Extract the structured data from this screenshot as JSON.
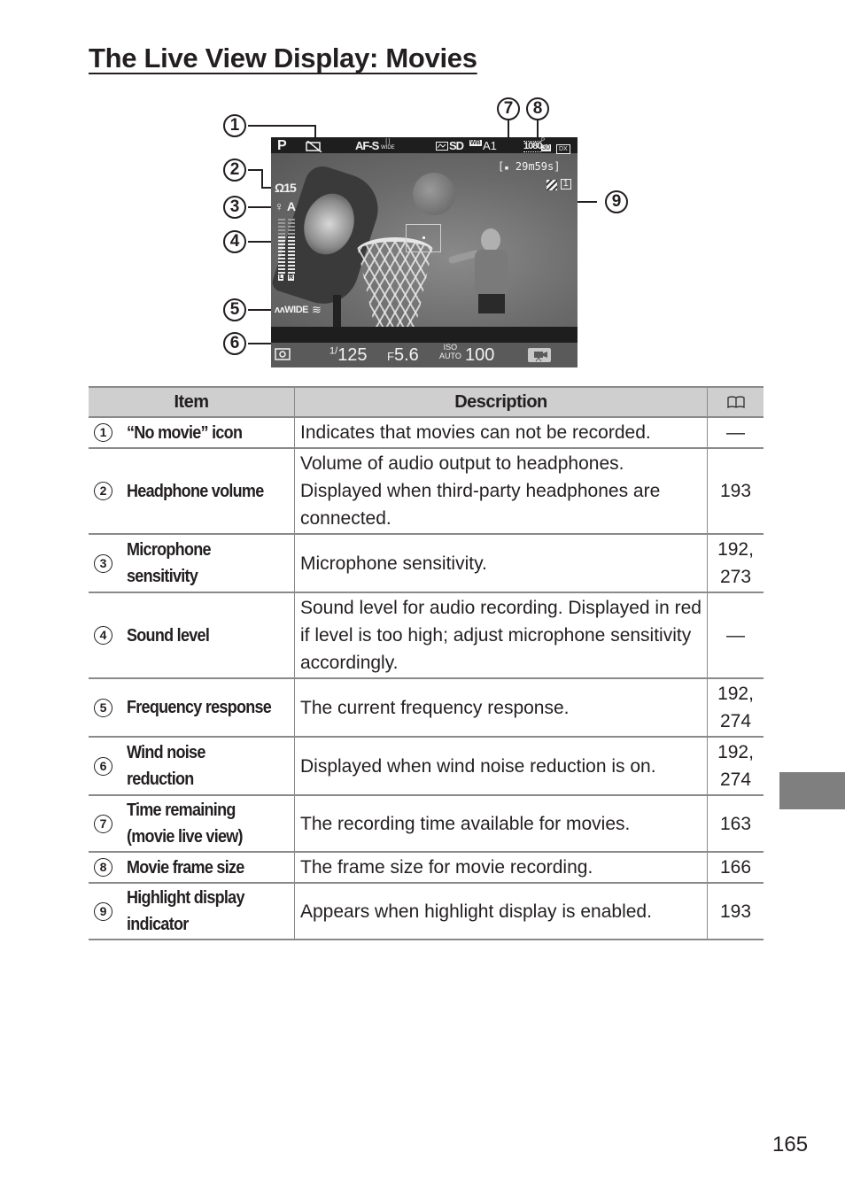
{
  "page": {
    "title": "The Live View Display: Movies",
    "page_number": "165"
  },
  "figure": {
    "callouts": [
      "1",
      "2",
      "3",
      "4",
      "5",
      "6",
      "7",
      "8",
      "9"
    ],
    "overlay": {
      "mode": "P",
      "no_movie_icon": "no-movie-icon",
      "focus_mode": "AF-S",
      "af_area_top": "[ ]",
      "af_area_bottom": "WIDE",
      "picture_control": "SD",
      "wb_label": "WB",
      "wb_value": "A1",
      "frame_size": "1080",
      "frame_rate_top": "P",
      "frame_rate": "30",
      "dx_label": "DX",
      "time_remaining": "29m59s",
      "headphone_volume": "15",
      "mic_sensitivity": "A",
      "meter_left": "L",
      "meter_right": "R",
      "frequency_response": "WIDE",
      "shutter_prefix": "1/",
      "shutter": "125",
      "aperture_prefix": "F",
      "aperture": "5.6",
      "iso_label_top": "ISO",
      "iso_label_bottom": "AUTO",
      "iso": "100"
    }
  },
  "table": {
    "headers": {
      "item": "Item",
      "description": "Description",
      "page_icon": "book-icon"
    },
    "rows": [
      {
        "num": "1",
        "item": "“No movie” icon",
        "description": "Indicates that movies can not be recorded.",
        "page": "—"
      },
      {
        "num": "2",
        "item": "Headphone volume",
        "description": "Volume of audio output to headphones. Displayed when third-party headphones are connected.",
        "page": "193"
      },
      {
        "num": "3",
        "item": "Microphone sensitivity",
        "description": "Microphone sensitivity.",
        "page": "192, 273"
      },
      {
        "num": "4",
        "item": "Sound level",
        "description": "Sound level for audio recording.  Displayed in red if level is too high; adjust microphone sensitivity accordingly.",
        "page": "—"
      },
      {
        "num": "5",
        "item": "Frequency response",
        "description": "The current frequency response.",
        "page": "192, 274"
      },
      {
        "num": "6",
        "item": "Wind noise reduction",
        "description": "Displayed when wind noise reduction is on.",
        "page": "192, 274"
      },
      {
        "num": "7",
        "item": "Time remaining (movie live view)",
        "description": "The recording time available for movies.",
        "page": "163"
      },
      {
        "num": "8",
        "item": "Movie frame size",
        "description": "The frame size for movie recording.",
        "page": "166"
      },
      {
        "num": "9",
        "item": "Highlight display indicator",
        "description": "Appears when highlight display is enabled.",
        "page": "193"
      }
    ]
  }
}
